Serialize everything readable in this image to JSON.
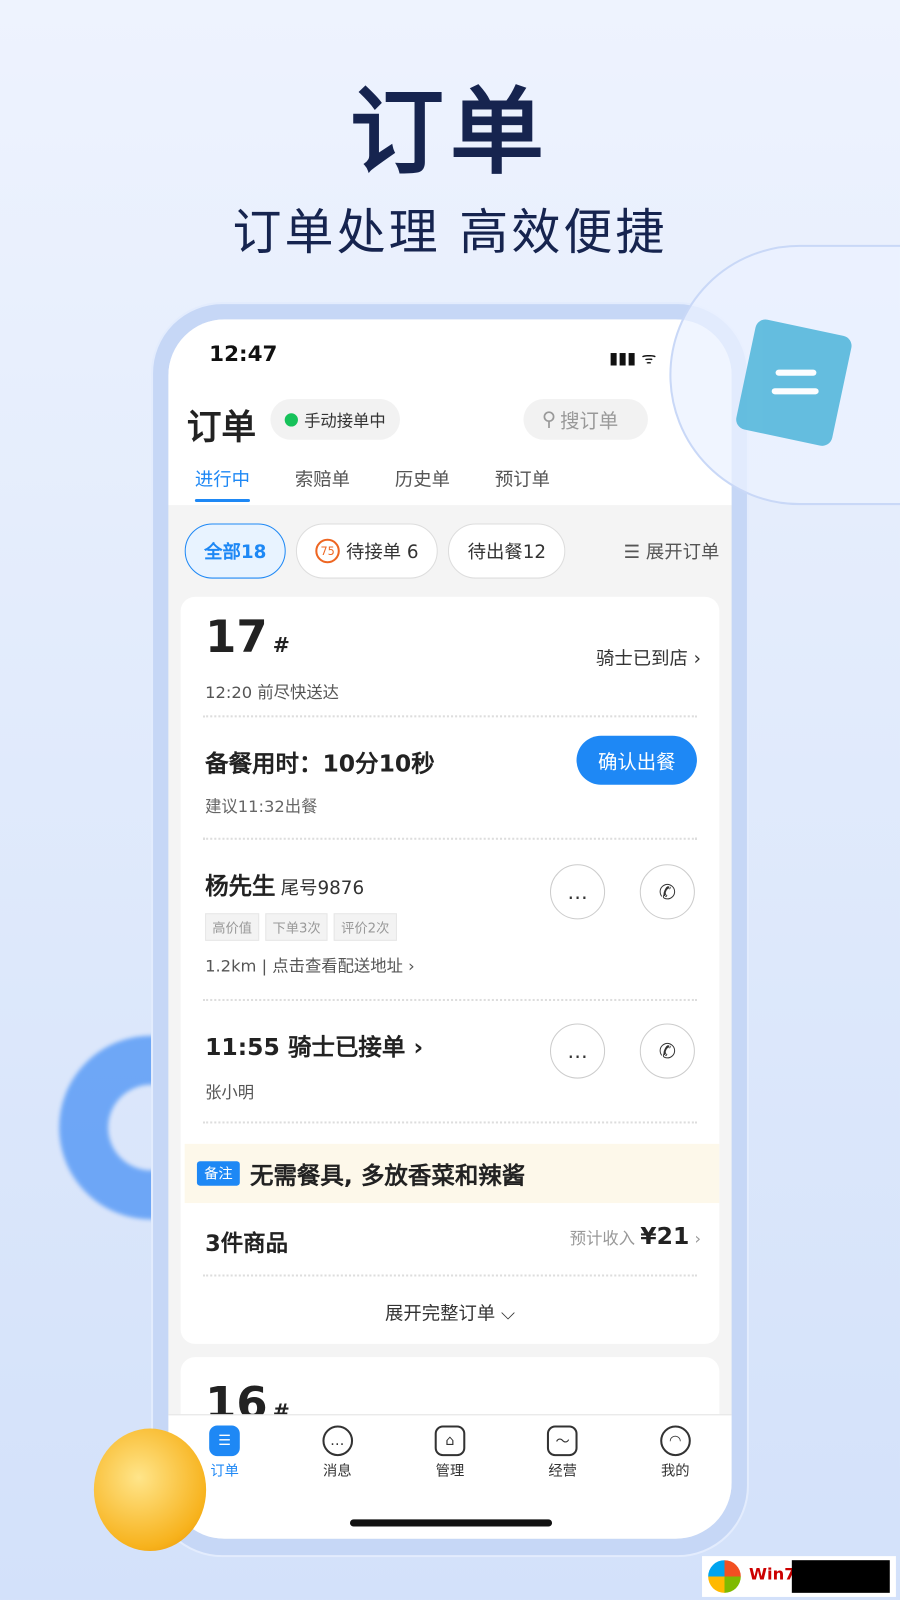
{
  "hero": {
    "title": "订单",
    "subtitle": "订单处理 高效便捷"
  },
  "status_bar": {
    "time": "12:47",
    "icons": "signal wifi battery"
  },
  "header": {
    "title": "订单",
    "mode": "手动接单中",
    "search_placeholder": "搜订单"
  },
  "tabs": [
    "进行中",
    "索赔单",
    "历史单",
    "预订单"
  ],
  "filters": {
    "all": "全部18",
    "pending_accept": "待接单 6",
    "pending_badge": "75",
    "pending_meal": "待出餐12",
    "expand": "展开订单"
  },
  "order": {
    "number": "17",
    "hash": "#",
    "deliver_by": "12:20 前尽快送达",
    "rider_status": "骑士已到店",
    "prep_time": "备餐用时：10分10秒",
    "suggest": "建议11:32出餐",
    "confirm_button": "确认出餐",
    "customer": "杨先生",
    "tail": "尾号9876",
    "tags": [
      "高价值",
      "下单3次",
      "评价2次"
    ],
    "distance": "1.2km",
    "address_link": "点击查看配送地址",
    "rider_line": "11:55 骑士已接单",
    "rider_name": "张小明",
    "note_label": "备注",
    "note": "无需餐具, 多放香菜和辣酱",
    "items": "3件商品",
    "income_label": "预计收入",
    "income": "¥21",
    "expand_full": "展开完整订单 ⌵"
  },
  "order2": {
    "number": "16",
    "hash": "#"
  },
  "nav": [
    "订单",
    "消息",
    "管理",
    "经营",
    "我的"
  ],
  "accent": "#1e88f5"
}
